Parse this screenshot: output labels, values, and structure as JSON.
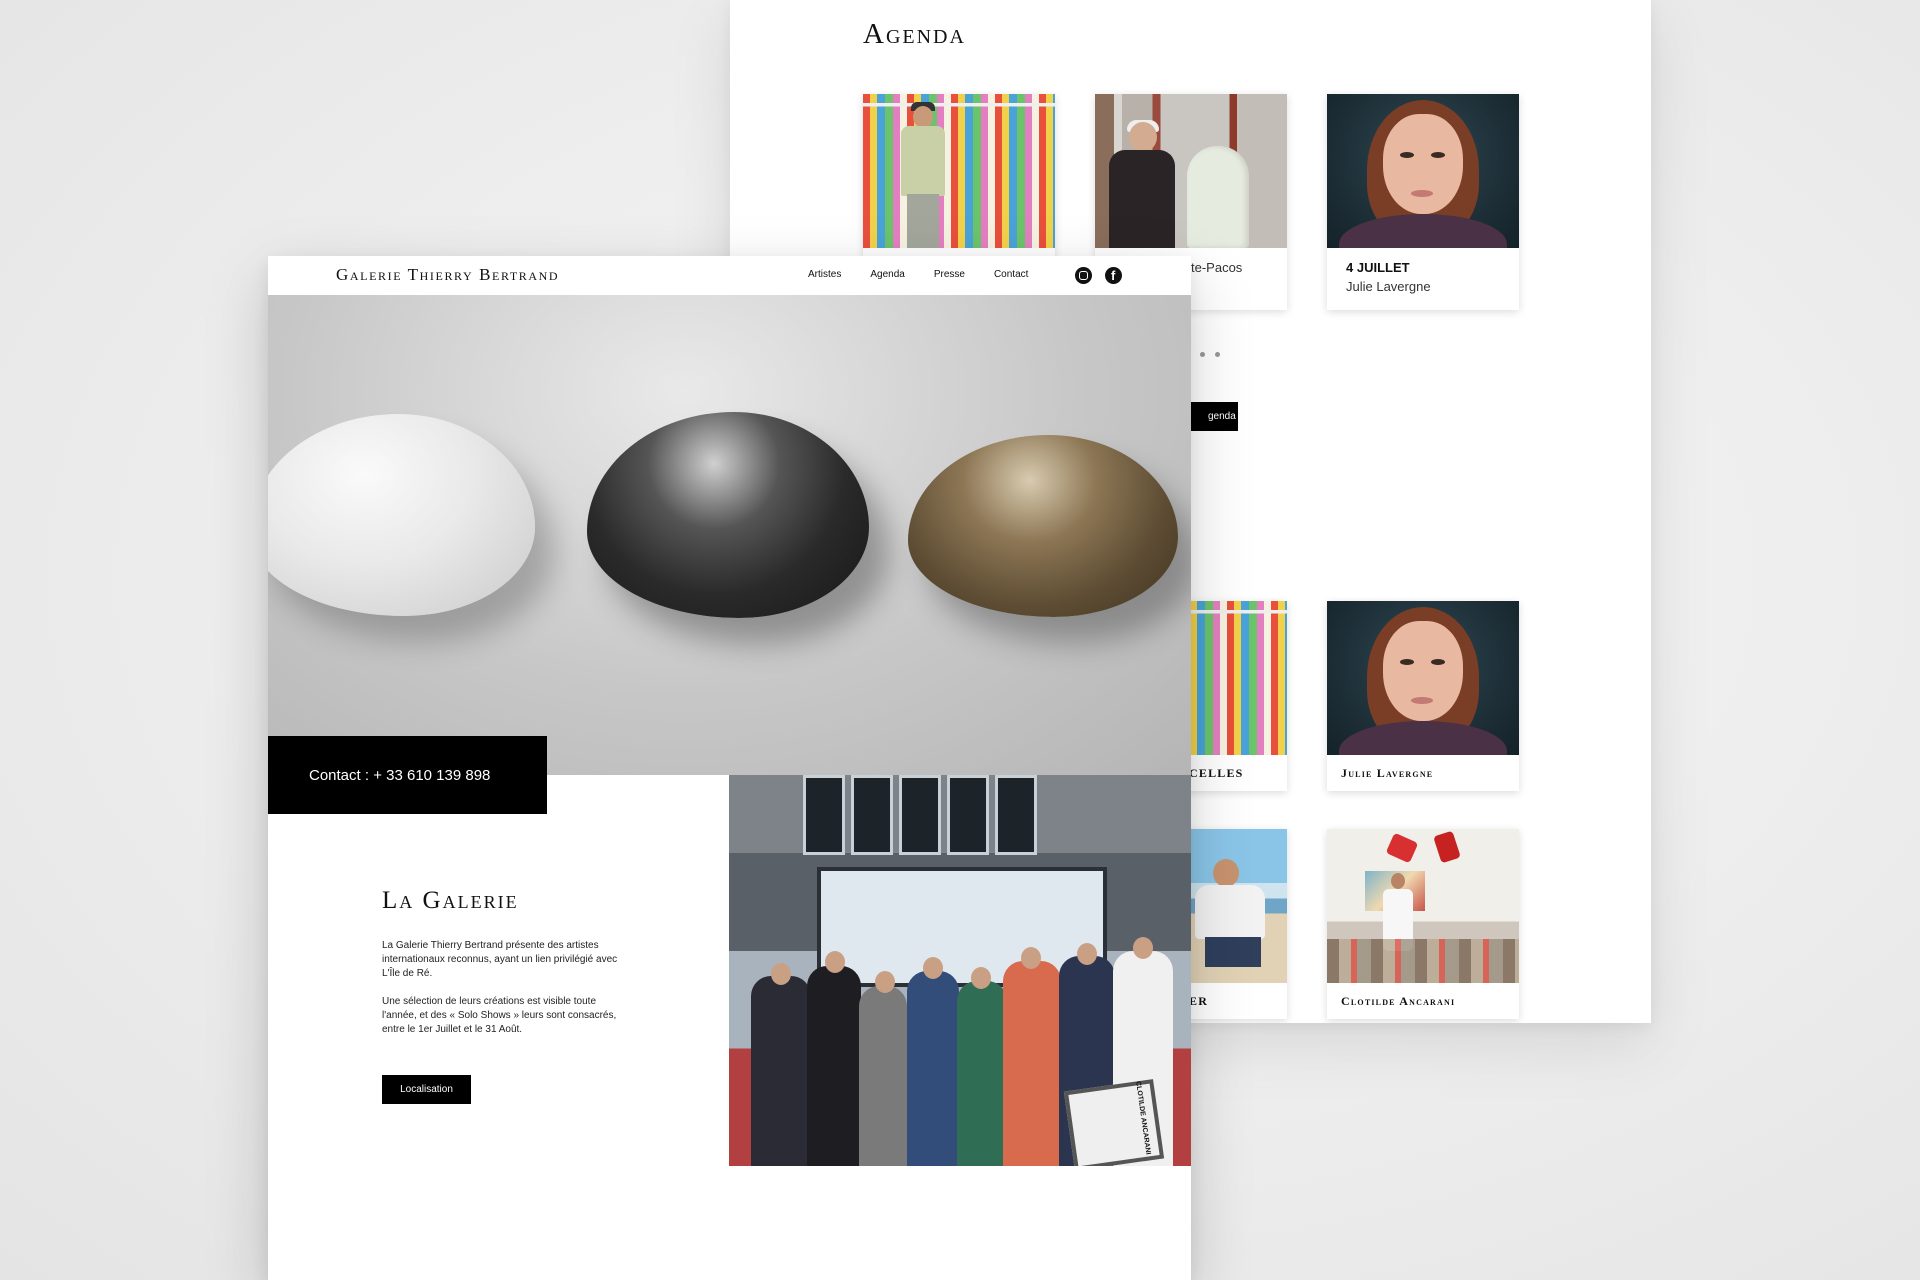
{
  "back_page": {
    "agenda_title": "Agenda",
    "cards_top": [
      {
        "date": "",
        "artist": "",
        "icon": "painter-photo"
      },
      {
        "date": "",
        "artist": "te-Pacos",
        "icon": "sculptor-photo"
      },
      {
        "date": "4 JUILLET",
        "artist": "Julie Lavergne",
        "icon": "portrait-photo"
      }
    ],
    "agenda_button_label": "genda",
    "cards_bottom": [
      {
        "name": "CELLES",
        "icon": "painting-photo"
      },
      {
        "name": "Julie Lavergne",
        "icon": "portrait-photo"
      },
      {
        "name": "ER",
        "icon": "beach-photo"
      },
      {
        "name": "Clotilde Ancarani",
        "icon": "studio-photo"
      }
    ]
  },
  "front_page": {
    "brand": "Galerie Thierry Bertrand",
    "nav": [
      "Artistes",
      "Agenda",
      "Presse",
      "Contact"
    ],
    "social_icons": [
      "instagram-icon",
      "facebook-icon"
    ],
    "contact": "Contact : + 33 610 139 898",
    "galerie": {
      "title": "La Galerie",
      "paragraph1": "La Galerie Thierry Bertrand présente des artistes internationaux reconnus, ayant un lien privilégié avec L'Île de Ré.",
      "paragraph2": "Une sélection de leurs créations est visible toute l'année, et des « Solo Shows » leurs sont consacrés, entre le  1er Juillet et le 31  Août.",
      "button": "Localisation"
    },
    "sign_text": "CLOTILDE ANCARANI"
  },
  "colors": {
    "background": "#ececec",
    "text": "#111111",
    "button_bg": "#000000",
    "button_text": "#ffffff"
  }
}
